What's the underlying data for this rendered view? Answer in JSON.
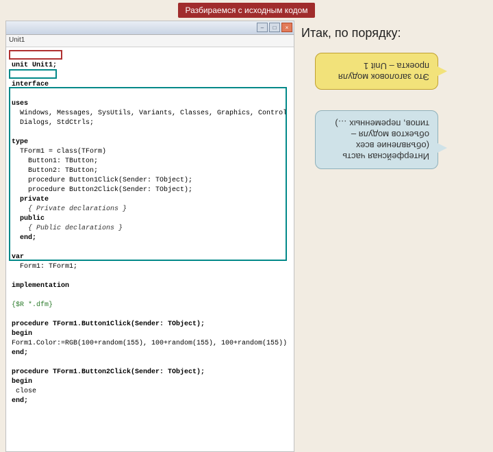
{
  "slide": {
    "title": "Разбираемся с исходным кодом",
    "side_heading": "Итак, по порядку:"
  },
  "window": {
    "tab": "Unit1",
    "buttons": {
      "min": "–",
      "max": "□",
      "close": "×"
    }
  },
  "code": {
    "l1": "unit Unit1;",
    "l2": "",
    "l3": "interface",
    "l4": "",
    "l5": "uses",
    "l6": "  Windows, Messages, SysUtils, Variants, Classes, Graphics, Control",
    "l7": "  Dialogs, StdCtrls;",
    "l8": "",
    "l9": "type",
    "l10": "  TForm1 = class(TForm)",
    "l11": "    Button1: TButton;",
    "l12": "    Button2: TButton;",
    "l13": "    procedure Button1Click(Sender: TObject);",
    "l14": "    procedure Button2Click(Sender: TObject);",
    "l15": "  private",
    "l16": "    { Private declarations }",
    "l17": "  public",
    "l18": "    { Public declarations }",
    "l19": "  end;",
    "l20": "",
    "l21": "var",
    "l22": "  Form1: TForm1;",
    "l23": "",
    "l24": "implementation",
    "l25": "",
    "l26": "{$R *.dfm}",
    "l27": "",
    "l28": "procedure TForm1.Button1Click(Sender: TObject);",
    "l29": "begin",
    "l30": "Form1.Color:=RGB(100+random(155), 100+random(155), 100+random(155))",
    "l31": "end;",
    "l32": "",
    "l33": "procedure TForm1.Button2Click(Sender: TObject);",
    "l34": "begin",
    "l35": " close",
    "l36": "end;"
  },
  "callouts": {
    "yellow": "Это заголовок модуля проекта – Unit 1",
    "blue": "Интерфейсная часть (объявление всех объектов модуля – типов, переменных …)"
  }
}
